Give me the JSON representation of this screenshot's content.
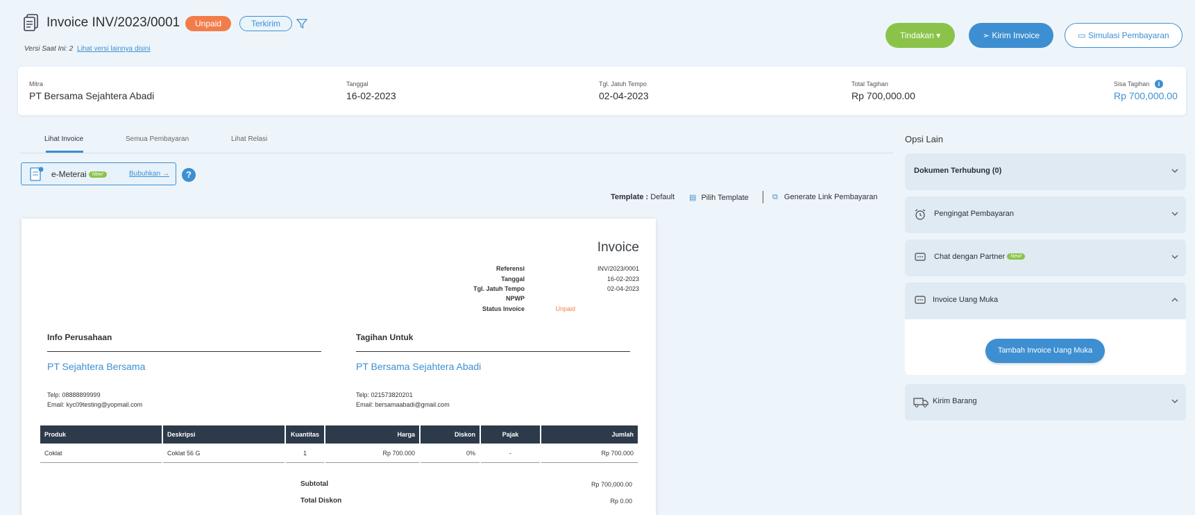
{
  "header": {
    "title": "Invoice INV/2023/0001",
    "status_badge": "Unpaid",
    "sent_badge": "Terkirim",
    "version_text": "Versi Saat Ini: 2",
    "version_link": "Lihat versi lainnya disini",
    "actions": {
      "tindakan": "Tindakan ▾",
      "kirim": "Kirim Invoice",
      "simulasi": "Simulasi Pembayaran"
    }
  },
  "summary": {
    "mitra_label": "Mitra",
    "mitra_value": "PT Bersama Sejahtera Abadi",
    "tanggal_label": "Tanggal",
    "tanggal_value": "16-02-2023",
    "jatuh_tempo_label": "Tgl. Jatuh Tempo",
    "jatuh_tempo_value": "02-04-2023",
    "total_label": "Total Tagihan",
    "total_value": "Rp 700,000.00",
    "sisa_label": "Sisa Tagihan",
    "sisa_value": "Rp 700,000.00"
  },
  "tabs": [
    "Lihat Invoice",
    "Semua Pembayaran",
    "Lihat Relasi"
  ],
  "emeterai": {
    "label": "e-Meterai",
    "new": "New!",
    "link": "Bubuhkan"
  },
  "template_bar": {
    "template_label": "Template :",
    "template_value": "Default",
    "pilih": "Pilih Template",
    "generate": "Generate Link Pembayaran"
  },
  "invoice": {
    "title": "Invoice",
    "meta": [
      {
        "label": "Referensi",
        "value": "INV/2023/0001"
      },
      {
        "label": "Tanggal",
        "value": "16-02-2023"
      },
      {
        "label": "Tgl. Jatuh Tempo",
        "value": "02-04-2023"
      },
      {
        "label": "NPWP",
        "value": ""
      },
      {
        "label": "Status Invoice",
        "value": "Unpaid"
      }
    ],
    "company": {
      "section": "Info Perusahaan",
      "name": "PT Sejahtera Bersama",
      "phone": "Telp: 08888899999",
      "email": "Email: kyc09testing@yopmail.com"
    },
    "bill_to": {
      "section": "Tagihan Untuk",
      "name": "PT Bersama Sejahtera Abadi",
      "phone": "Telp: 021573820201",
      "email": "Email: bersamaabadi@gmail.com"
    },
    "table": {
      "headers": [
        "Produk",
        "Deskripsi",
        "Kuantitas",
        "Harga",
        "Diskon",
        "Pajak",
        "Jumlah"
      ],
      "rows": [
        [
          "Coklat",
          "Coklat 56 G",
          "1",
          "Rp 700.000",
          "0%",
          "-",
          "Rp 700.000"
        ]
      ]
    },
    "totals": [
      {
        "label": "Subtotal",
        "value": "Rp 700,000.00"
      },
      {
        "label": "Total Diskon",
        "value": "Rp 0.00"
      }
    ]
  },
  "right_panel": {
    "title": "Opsi Lain",
    "sections": [
      {
        "label": "Dokumen Terhubung (0)"
      },
      {
        "label": "Pengingat Pembayaran"
      },
      {
        "label": "Chat dengan Partner",
        "new": "New!"
      },
      {
        "label": "Invoice Uang Muka",
        "button": "Tambah Invoice Uang Muka"
      },
      {
        "label": "Kirim Barang"
      }
    ]
  }
}
